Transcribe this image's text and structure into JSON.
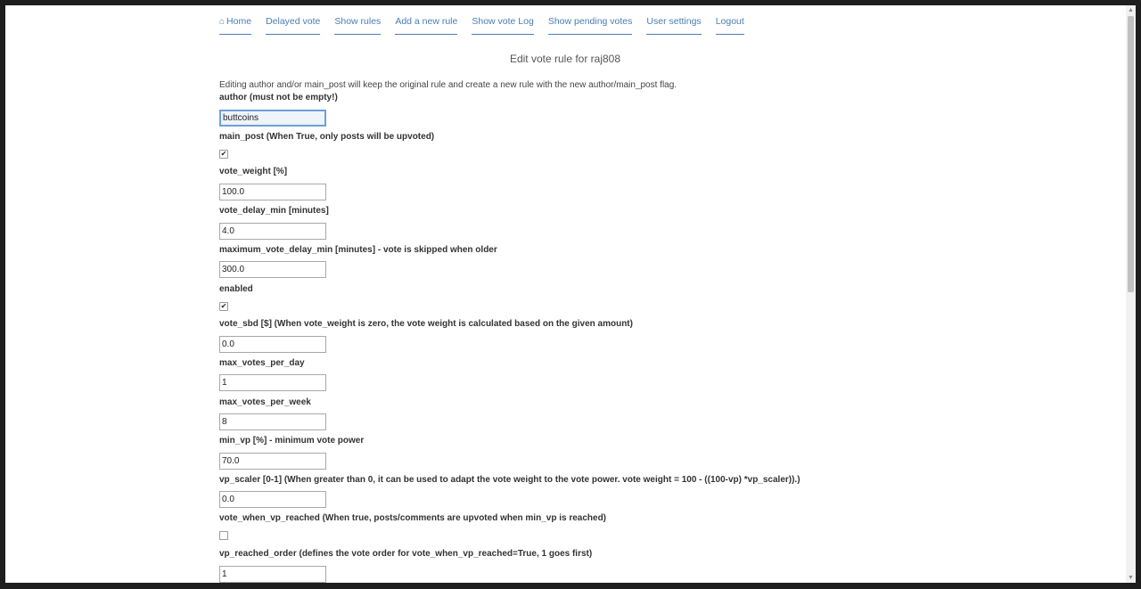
{
  "nav": {
    "home_icon": "home-icon",
    "items": [
      "Home",
      "Delayed vote",
      "Show rules",
      "Add a new rule",
      "Show vote Log",
      "Show pending votes",
      "User settings",
      "Logout"
    ]
  },
  "page_title": "Edit vote rule for raj808",
  "note": "Editing author and/or main_post will keep the original rule and create a new rule with the new author/main_post flag.",
  "fields": {
    "author": {
      "label": "author (must not be empty!)",
      "value": "buttcoins"
    },
    "main_post": {
      "label": "main_post (When True, only posts will be upvoted)",
      "checked": true
    },
    "vote_weight": {
      "label": "vote_weight [%]",
      "value": "100.0"
    },
    "vote_delay_min": {
      "label": "vote_delay_min [minutes]",
      "value": "4.0"
    },
    "maximum_vote_delay_min": {
      "label": "maximum_vote_delay_min [minutes] - vote is skipped when older",
      "value": "300.0"
    },
    "enabled": {
      "label": "enabled",
      "checked": true
    },
    "vote_sbd": {
      "label": "vote_sbd [$] (When vote_weight is zero, the vote weight is calculated based on the given amount)",
      "value": "0.0"
    },
    "max_votes_per_day": {
      "label": "max_votes_per_day",
      "value": "1"
    },
    "max_votes_per_week": {
      "label": "max_votes_per_week",
      "value": "8"
    },
    "min_vp": {
      "label": "min_vp [%] - minimum vote power",
      "value": "70.0"
    },
    "vp_scaler": {
      "label": "vp_scaler [0-1] (When greater than 0, it can be used to adapt the vote weight to the vote power. vote weight = 100 - ((100-vp) *vp_scaler)).)",
      "value": "0.0"
    },
    "vote_when_vp_reached": {
      "label": "vote_when_vp_reached (When true, posts/comments are upvoted when min_vp is reached)",
      "checked": false
    },
    "vp_reached_order": {
      "label": "vp_reached_order (defines the vote order for vote_when_vp_reached=True, 1 goes first)",
      "value": "1"
    }
  }
}
